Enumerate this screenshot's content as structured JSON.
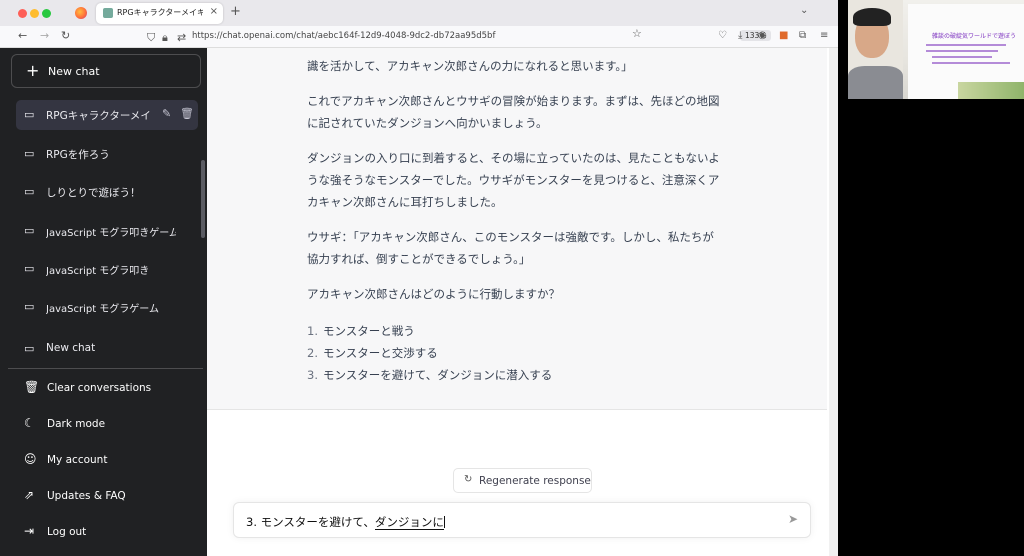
{
  "browser": {
    "tab_title": "RPGキャラクターメイキング",
    "tab_close": "×",
    "new_tab": "+",
    "url": "https://chat.openai.com/chat/aebc164f-12d9-4048-9dc2-db72aa95d5bf",
    "zoom": "133%"
  },
  "sidebar": {
    "new_chat_label": "New chat",
    "conversations": [
      {
        "label": "RPGキャラクターメイ",
        "active": true
      },
      {
        "label": "RPGを作ろう"
      },
      {
        "label": "しりとりで遊ぼう！"
      },
      {
        "label": "JavaScript モグラ叩きゲーム"
      },
      {
        "label": "JavaScript モグラ叩き"
      },
      {
        "label": "JavaScript モグラゲーム"
      },
      {
        "label": "New chat"
      }
    ],
    "bottom": [
      {
        "label": "Clear conversations",
        "icon": "trash-icon"
      },
      {
        "label": "Dark mode",
        "icon": "moon-icon"
      },
      {
        "label": "My account",
        "icon": "user-icon"
      },
      {
        "label": "Updates & FAQ",
        "icon": "external-link-icon"
      },
      {
        "label": "Log out",
        "icon": "logout-icon"
      }
    ]
  },
  "chat": {
    "paragraphs": [
      "識を活かして、アカキャン次郎さんの力になれると思います。」",
      "これでアカキャン次郎さんとウサギの冒険が始まります。まずは、先ほどの地図に記されていたダンジョンへ向かいましょう。",
      "ダンジョンの入り口に到着すると、その場に立っていたのは、見たこともないような強そうなモンスターでした。ウサギがモンスターを見つけると、注意深くアカキャン次郎さんに耳打ちしました。",
      "ウサギ：「アカキャン次郎さん、このモンスターは強敵です。しかし、私たちが協力すれば、倒すことができるでしょう。」",
      "アカキャン次郎さんはどのように行動しますか？"
    ],
    "options": [
      {
        "num": "1.",
        "text": "モンスターと戦う"
      },
      {
        "num": "2.",
        "text": "モンスターと交渉する"
      },
      {
        "num": "3.",
        "text": "モンスターを避けて、ダンジョンに潜入する"
      }
    ],
    "regenerate_label": "Regenerate response",
    "input_committed": "3. モンスターを避けて、",
    "input_composing": "ダンジョンに"
  },
  "webcam": {
    "slide_title": "雑談の破綻気ワールドで遊ぼう"
  }
}
